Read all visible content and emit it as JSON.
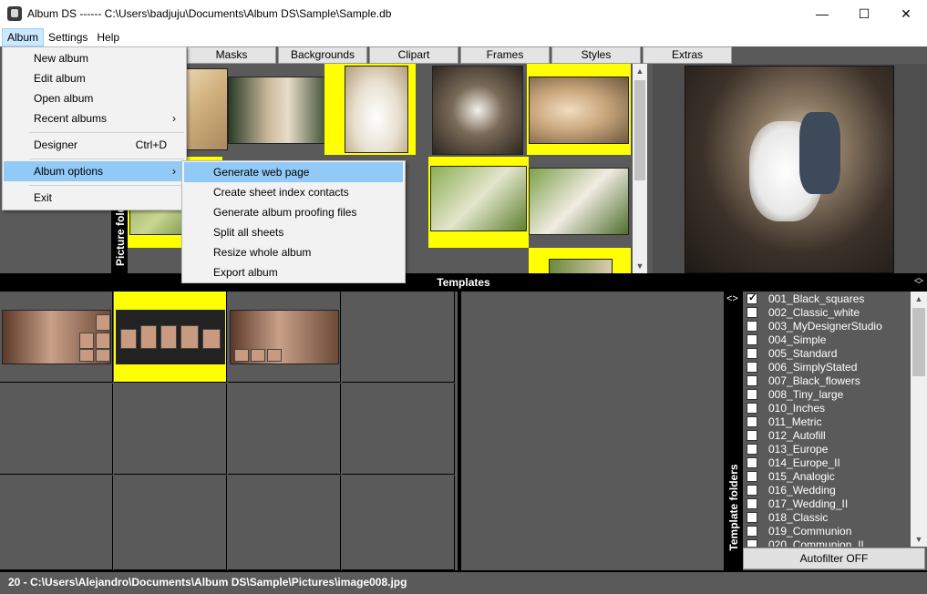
{
  "window": {
    "title": "Album DS ------   C:\\Users\\badjuju\\Documents\\Album DS\\Sample\\Sample.db",
    "minimize": "—",
    "maximize": "☐",
    "close": "✕"
  },
  "menubar": {
    "items": [
      "Album",
      "Settings",
      "Help"
    ]
  },
  "tabs": [
    "Masks",
    "Backgrounds",
    "Clipart",
    "Frames",
    "Styles",
    "Extras"
  ],
  "photo_panel": {
    "side_label": "Picture folders"
  },
  "templates_header": "Templates",
  "template_folders": {
    "label": "Template folders",
    "items": [
      {
        "name": "001_Black_squares",
        "checked": true
      },
      {
        "name": "002_Classic_white",
        "checked": false
      },
      {
        "name": "003_MyDesignerStudio",
        "checked": false
      },
      {
        "name": "004_Simple",
        "checked": false
      },
      {
        "name": "005_Standard",
        "checked": false
      },
      {
        "name": "006_SimplyStated",
        "checked": false
      },
      {
        "name": "007_Black_flowers",
        "checked": false
      },
      {
        "name": "008_Tiny_large",
        "checked": false
      },
      {
        "name": "010_Inches",
        "checked": false
      },
      {
        "name": "011_Metric",
        "checked": false
      },
      {
        "name": "012_Autofill",
        "checked": false
      },
      {
        "name": "013_Europe",
        "checked": false
      },
      {
        "name": "014_Europe_II",
        "checked": false
      },
      {
        "name": "015_Analogic",
        "checked": false
      },
      {
        "name": "016_Wedding",
        "checked": false
      },
      {
        "name": "017_Wedding_II",
        "checked": false
      },
      {
        "name": "018_Classic",
        "checked": false
      },
      {
        "name": "019_Communion",
        "checked": false
      },
      {
        "name": "020_Communion_II",
        "checked": false
      }
    ],
    "autofilter_label": "Autofilter OFF"
  },
  "statusbar": "20  -  C:\\Users\\Alejandro\\Documents\\Album DS\\Sample\\Pictures\\image008.jpg",
  "album_menu": {
    "new_album": "New album",
    "edit_album": "Edit album",
    "open_album": "Open album",
    "recent_albums": "Recent albums",
    "designer": "Designer",
    "designer_shortcut": "Ctrl+D",
    "album_options": "Album options",
    "exit": "Exit"
  },
  "album_options_submenu": [
    "Generate web page",
    "Create sheet index contacts",
    "Generate album proofing files",
    "Split all sheets",
    "Resize whole album",
    "Export album"
  ],
  "colors": {
    "selection_yellow": "#ffff00",
    "menu_highlight": "#91c9f7",
    "panel_bg": "#5a5a5a"
  }
}
